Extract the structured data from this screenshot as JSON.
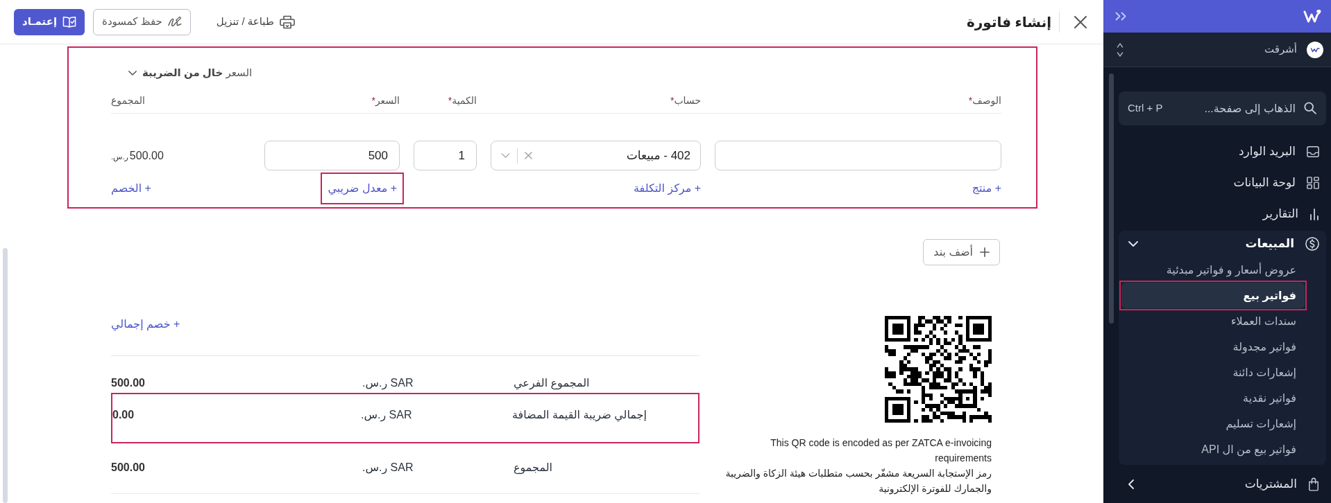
{
  "sidebar": {
    "organization": {
      "name": "أشرقت"
    },
    "search": {
      "placeholder": "الذهاب إلى صفحة...",
      "shortcut": "Ctrl + P"
    },
    "items": [
      {
        "kind": "link",
        "label": "البريد الوارد"
      },
      {
        "kind": "link",
        "label": "لوحة البيانات"
      },
      {
        "kind": "link",
        "label": "التقارير"
      },
      {
        "kind": "group",
        "label": "المبيعات",
        "expanded": true,
        "children": [
          {
            "label": "عروض أسعار و فواتير مبدئية",
            "selected": false,
            "highlighted": false
          },
          {
            "label": "فواتير بيع",
            "selected": true,
            "highlighted": true
          },
          {
            "label": "سندات العملاء",
            "selected": false,
            "highlighted": false
          },
          {
            "label": "فواتير مجدولة",
            "selected": false,
            "highlighted": false
          },
          {
            "label": "إشعارات دائنة",
            "selected": false,
            "highlighted": false
          },
          {
            "label": "فواتير نقدية",
            "selected": false,
            "highlighted": false
          },
          {
            "label": "إشعارات تسليم",
            "selected": false,
            "highlighted": false
          },
          {
            "label": "فواتير بيع من ال API",
            "selected": false,
            "highlighted": false
          }
        ]
      },
      {
        "kind": "group",
        "label": "المشتريات",
        "expanded": false
      }
    ]
  },
  "header": {
    "title": "إنشاء فاتورة",
    "actions": [
      {
        "kind": "link",
        "label": "طباعة / تنزيل"
      },
      {
        "kind": "secondary",
        "label": "حفظ كمسودة"
      },
      {
        "kind": "primary",
        "label": "إعتمـاد"
      }
    ]
  },
  "line_items": {
    "highlighted": true,
    "price_mode": {
      "label": "السعر **خال من الضريبة**"
    },
    "columns": [
      {
        "label": "الوصف",
        "required_mark": "*"
      },
      {
        "label": "حساب",
        "required_mark": "*"
      },
      {
        "label": "الكمية",
        "required_mark": "*"
      },
      {
        "label": "السعر",
        "required_mark": "*"
      },
      {
        "label": "المجموع"
      }
    ],
    "rows": [
      {
        "cells": [
          {
            "kind": "text_input",
            "link": {
              "label": "+ منتج",
              "highlighted": false
            }
          },
          {
            "kind": "select",
            "value": "402 - مبيعات",
            "link": {
              "label": "+ مركز التكلفة",
              "highlighted": false
            }
          },
          {
            "kind": "number_input",
            "value": "1"
          },
          {
            "kind": "number_input",
            "value": "500",
            "link": {
              "label": "+ معدل ضريبي",
              "highlighted": true
            }
          },
          {
            "kind": "amount",
            "value": "500.00",
            "currency": "ر.س.",
            "link": {
              "label": "+ الخصم",
              "highlighted": false
            }
          }
        ]
      }
    ],
    "add_button": {
      "label": "أضف بند"
    }
  },
  "zatca_qr": {
    "captions": [
      "This QR code is encoded as per ZATCA e-invoicing requirements",
      "رمز الإستجابة السريعة مشفّر بحسب متطلبات هيئة الزكاة والضريبة والجمارك للفوترة الإلكترونية"
    ]
  },
  "totals": {
    "discount_link": "+ خصم إجمالي",
    "rows": [
      {
        "label": "المجموع الفرعي",
        "currency": "SAR ر.س.",
        "value": "500.00",
        "highlighted": false
      },
      {
        "label": "إجمالي ضريبة القيمة المضافة",
        "currency": "SAR ر.س.",
        "value": "0.00",
        "highlighted": true
      },
      {
        "label": "المجموع",
        "currency": "SAR ر.س.",
        "value": "500.00",
        "highlighted": false
      }
    ]
  }
}
